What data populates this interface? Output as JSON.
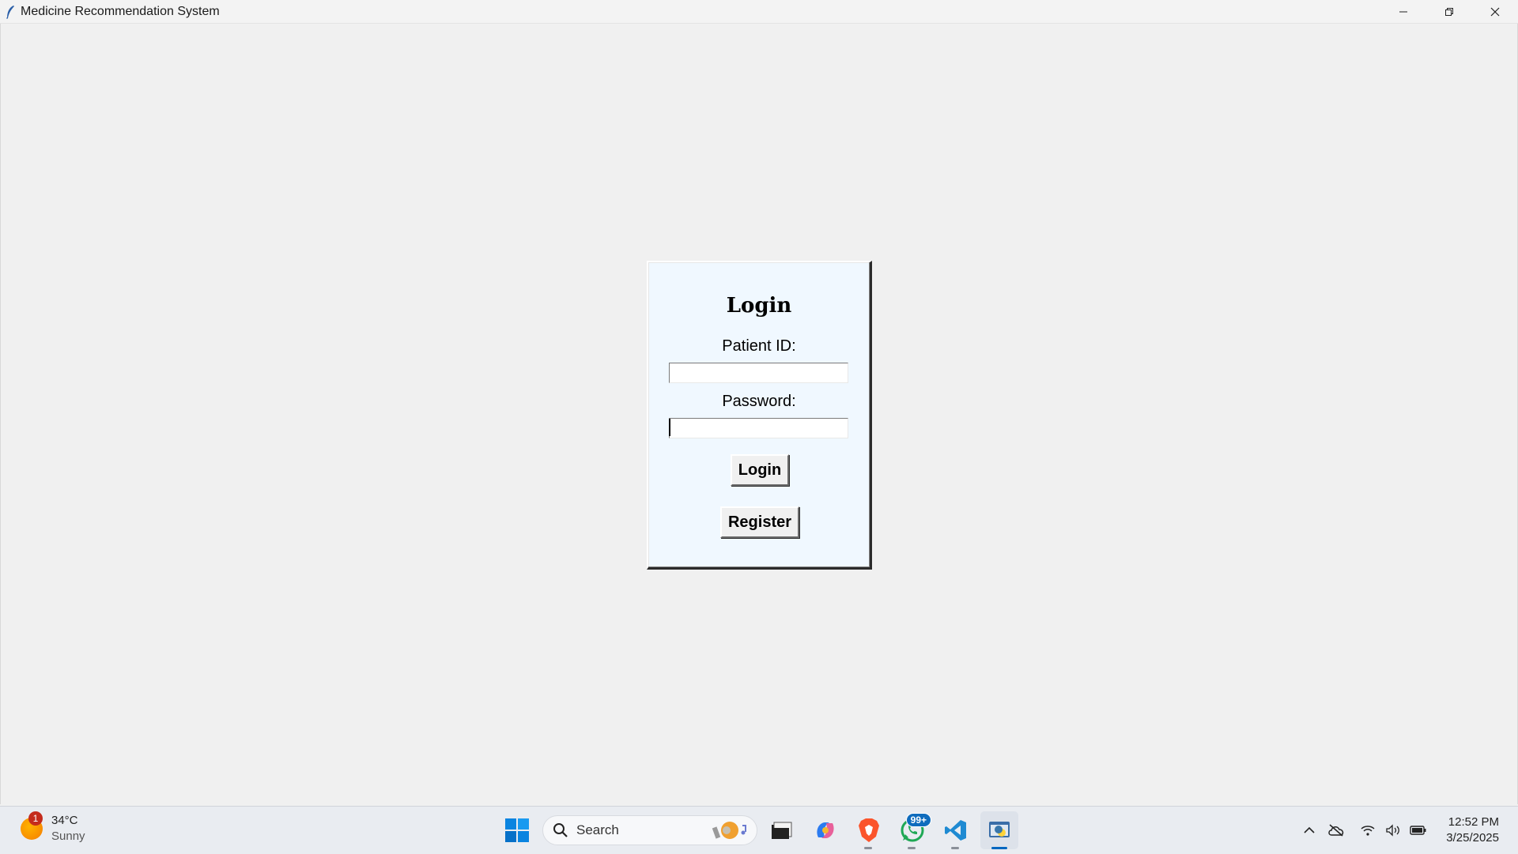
{
  "window": {
    "title": "Medicine Recommendation System"
  },
  "login": {
    "heading": "Login",
    "patient_id_label": "Patient ID:",
    "patient_id_value": "",
    "password_label": "Password:",
    "password_value": "",
    "login_button": "Login",
    "register_button": "Register"
  },
  "taskbar": {
    "weather": {
      "temp": "34°C",
      "condition": "Sunny",
      "badge": "1"
    },
    "search_label": "Search",
    "whatsapp_badge": "99+",
    "clock": {
      "time": "12:52 PM",
      "date": "3/25/2025"
    }
  },
  "colors": {
    "card_bg": "#f0f8ff",
    "window_bg": "#f0f0f0",
    "accent": "#0067c0"
  },
  "icons": {
    "app": "feather-icon",
    "minimize": "minimize-icon",
    "restore": "restore-icon",
    "close": "close-icon",
    "start": "windows-start-icon",
    "search": "search-icon",
    "file_explorer": "file-explorer-icon",
    "copilot": "copilot-icon",
    "brave": "brave-browser-icon",
    "whatsapp": "whatsapp-icon",
    "vscode": "vscode-icon",
    "python_app": "python-app-icon"
  }
}
